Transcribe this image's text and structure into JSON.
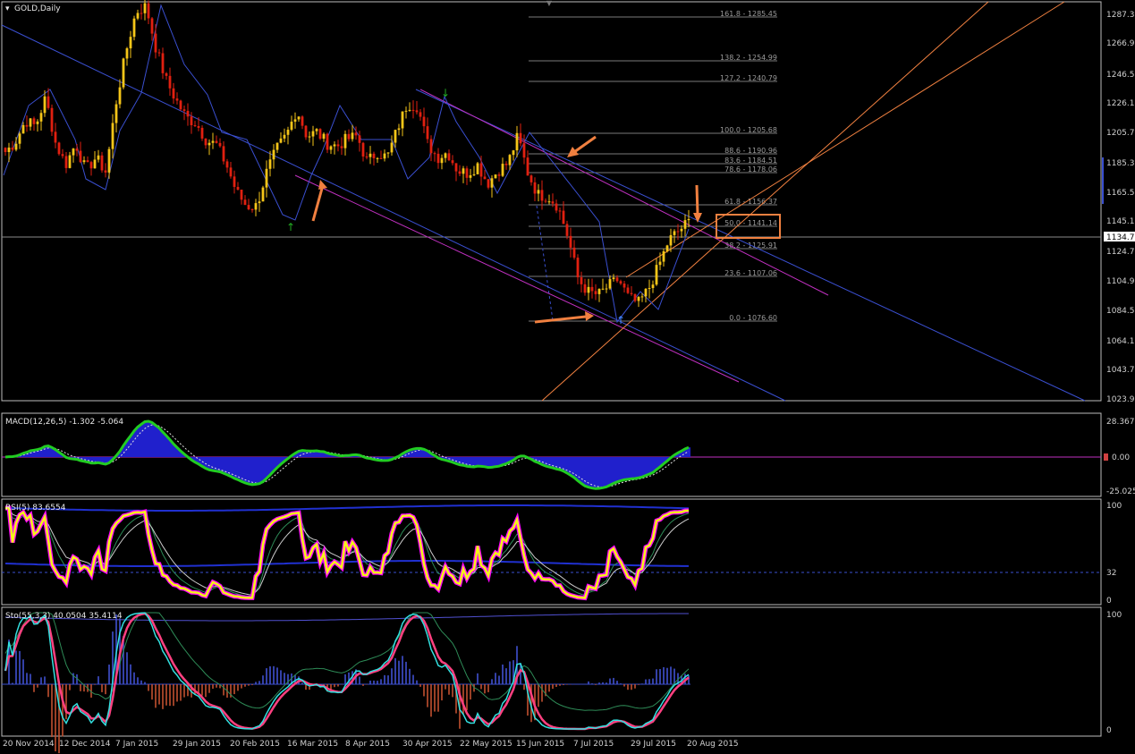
{
  "main": {
    "title": "GOLD,Daily",
    "price_ticks": [
      "1287.31",
      "1266.91",
      "1246.51",
      "1226.11",
      "1205.71",
      "1185.31",
      "1165.51",
      "1145.11",
      "1124.71",
      "1104.91",
      "1084.51",
      "1064.11",
      "1043.71",
      "1023.91"
    ],
    "current_price": "1134.71",
    "fib_levels": [
      {
        "label": "161.8 - 1285.45"
      },
      {
        "label": "138.2 - 1254.99"
      },
      {
        "label": "127.2 - 1240.79"
      },
      {
        "label": "100.0 - 1205.68"
      },
      {
        "label": "88.6 - 1190.96"
      },
      {
        "label": "83.6 - 1184.51"
      },
      {
        "label": "78.6 - 1178.06"
      },
      {
        "label": "61.8 - 1156.37"
      },
      {
        "label": "50.0 - 1141.14"
      },
      {
        "label": "38.2 - 1125.91"
      },
      {
        "label": "23.6 - 1107.06"
      },
      {
        "label": "0.0 - 1076.60"
      }
    ]
  },
  "macd": {
    "title": "MACD(12,26,5) -1.302 -5.064",
    "ticks": [
      "28.367",
      "0.00",
      "-25.025"
    ]
  },
  "rsi": {
    "title": "RSI(5) 83.6554",
    "ticks": [
      "100",
      "32",
      "0"
    ]
  },
  "sto": {
    "title": "Sto(55,3,3) 40.0504 35.4114",
    "ticks": [
      "100",
      "0"
    ]
  },
  "dates": [
    "20 Nov 2014",
    "12 Dec 2014",
    "7 Jan 2015",
    "29 Jan 2015",
    "20 Feb 2015",
    "16 Mar 2015",
    "8 Apr 2015",
    "30 Apr 2015",
    "22 May 2015",
    "15 Jun 2015",
    "7 Jul 2015",
    "29 Jul 2015",
    "20 Aug 2015"
  ],
  "colors": {
    "bull": "#f5c518",
    "bear": "#e02010",
    "trend": "#3a4fd0",
    "channel": "#c030c0",
    "orange": "#f08040",
    "macd_line": "#22cc22",
    "macd_hist": "#2020cc",
    "rsi_line": "#f5f518",
    "rsi_halo": "#ff00ff",
    "sto_main": "#33e0e0",
    "sto_signal": "#ff4080"
  },
  "chart_data": {
    "type": "candlestick",
    "symbol": "GOLD",
    "timeframe": "Daily",
    "ylim": [
      1016,
      1295
    ],
    "x": [
      "20 Nov 2014",
      "12 Dec 2014",
      "7 Jan 2015",
      "29 Jan 2015",
      "20 Feb 2015",
      "16 Mar 2015",
      "8 Apr 2015",
      "30 Apr 2015",
      "22 May 2015",
      "15 Jun 2015",
      "7 Jul 2015",
      "29 Jul 2015",
      "20 Aug 2015"
    ],
    "close_path": [
      1190,
      1197,
      1212,
      1208,
      1228,
      1196,
      1181,
      1196,
      1177,
      1186,
      1176,
      1224,
      1260,
      1288,
      1292,
      1262,
      1240,
      1226,
      1214,
      1210,
      1198,
      1195,
      1181,
      1162,
      1152,
      1152,
      1176,
      1192,
      1202,
      1220,
      1201,
      1204,
      1196,
      1194,
      1199,
      1201,
      1183,
      1190,
      1186,
      1206,
      1224,
      1222,
      1196,
      1186,
      1190,
      1177,
      1175,
      1181,
      1168,
      1177,
      1182,
      1201,
      1175,
      1160,
      1159,
      1152,
      1130,
      1101,
      1092,
      1090,
      1096,
      1101,
      1088,
      1084,
      1094,
      1110,
      1128,
      1135,
      1141
    ]
  }
}
